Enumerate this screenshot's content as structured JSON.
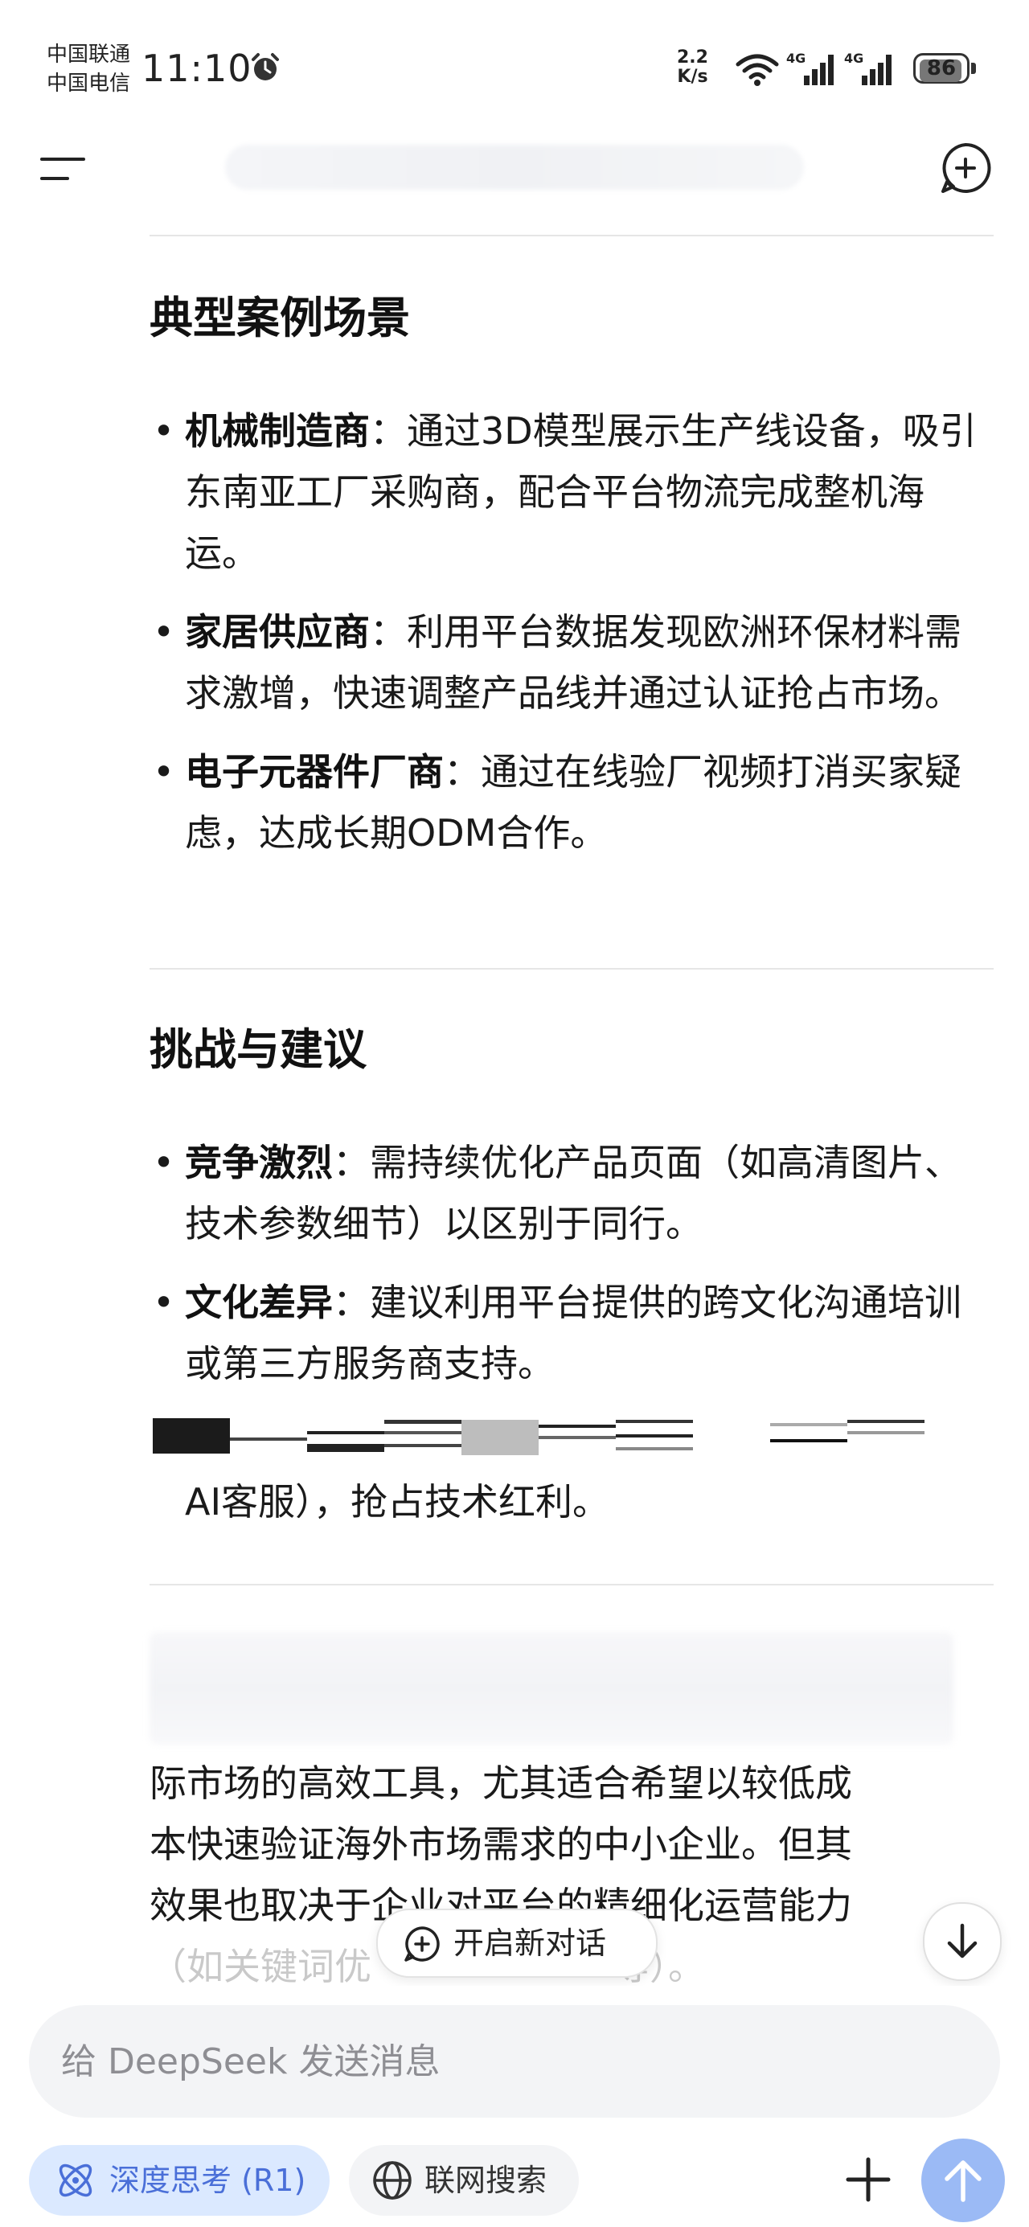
{
  "status_bar": {
    "carrier1": "中国联通",
    "carrier2": "中国电信",
    "time": "11:10",
    "net_speed_value": "2.2",
    "net_speed_unit": "K/s",
    "signal1_label": "4G",
    "signal2_label": "4G",
    "battery_level": "86"
  },
  "header": {
    "menu_icon": "hamburger-menu-icon",
    "new_chat_icon": "new-chat-icon"
  },
  "sections": {
    "cases": {
      "title": "典型案例场景",
      "items": [
        {
          "bold": "机械制造商",
          "text": "：通过3D模型展示生产线设备，吸引东南亚工厂采购商，配合平台物流完成整机海运。"
        },
        {
          "bold": "家居供应商",
          "text": "：利用平台数据发现欧洲环保材料需求激增，快速调整产品线并通过认证抢占市场。"
        },
        {
          "bold": "电子元器件厂商",
          "text": "：通过在线验厂视频打消买家疑虑，达成长期ODM合作。"
        }
      ]
    },
    "challenges": {
      "title": "挑战与建议",
      "items": [
        {
          "bold": "竞争激烈",
          "text": "：需持续优化产品页面（如高清图片、技术参数细节）以区别于同行。"
        },
        {
          "bold": "文化差异",
          "text": "：建议利用平台提供的跨文化沟通培训或第三方服务商支持。"
        }
      ],
      "tail": "AI客服），抢占技术红利。"
    }
  },
  "summary": {
    "line1": "际市场的高效工具，尤其适合希望以较低成",
    "line2": "本快速验证海外市场需求的中小企业。但其",
    "line3": "效果也取决于企业对平台的精细化运营能力",
    "line4": "（如关键词优",
    "line4_end": "等）。"
  },
  "floating": {
    "new_chat_label": "开启新对话",
    "scroll_down_icon": "arrow-down-icon"
  },
  "composer": {
    "placeholder": "给 DeepSeek 发送消息",
    "deep_think_label": "深度思考 (R1)",
    "web_search_label": "联网搜索",
    "accent": "#4a6fd8",
    "send_color": "#9bbaf5"
  }
}
